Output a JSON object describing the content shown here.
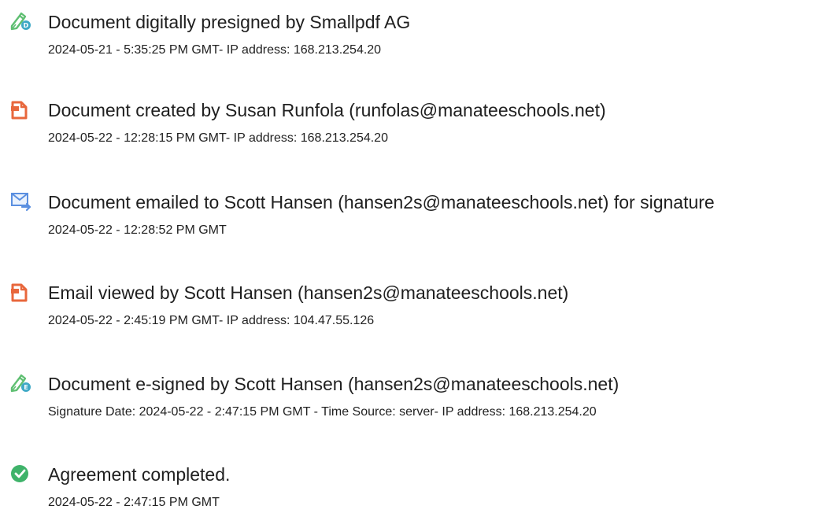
{
  "events": [
    {
      "icon": "pen-signature-icon",
      "title": "Document digitally presigned by Smallpdf AG",
      "detail": "2024-05-21 - 5:35:25 PM GMT- IP address: 168.213.254.20"
    },
    {
      "icon": "document-created-icon",
      "title": "Document created by Susan Runfola (runfolas@manateeschools.net)",
      "detail": "2024-05-22 - 12:28:15 PM GMT- IP address: 168.213.254.20"
    },
    {
      "icon": "email-sent-icon",
      "title": "Document emailed to Scott Hansen (hansen2s@manateeschools.net) for signature",
      "detail": "2024-05-22 - 12:28:52 PM GMT"
    },
    {
      "icon": "document-viewed-icon",
      "title": "Email viewed by Scott Hansen (hansen2s@manateeschools.net)",
      "detail": "2024-05-22 - 2:45:19 PM GMT- IP address: 104.47.55.126"
    },
    {
      "icon": "pen-signature-icon",
      "title": "Document e-signed by Scott Hansen (hansen2s@manateeschools.net)",
      "detail": "Signature Date: 2024-05-22 - 2:47:15 PM GMT - Time Source: server- IP address: 168.213.254.20"
    },
    {
      "icon": "check-circle-icon",
      "title": "Agreement completed.",
      "detail": "2024-05-22 - 2:47:15 PM GMT"
    }
  ],
  "colors": {
    "pen_green": "#5fbf72",
    "doc_orange": "#e8673c",
    "mail_blue": "#5a8fe0",
    "check_green": "#3fb36a",
    "text": "#202020"
  }
}
